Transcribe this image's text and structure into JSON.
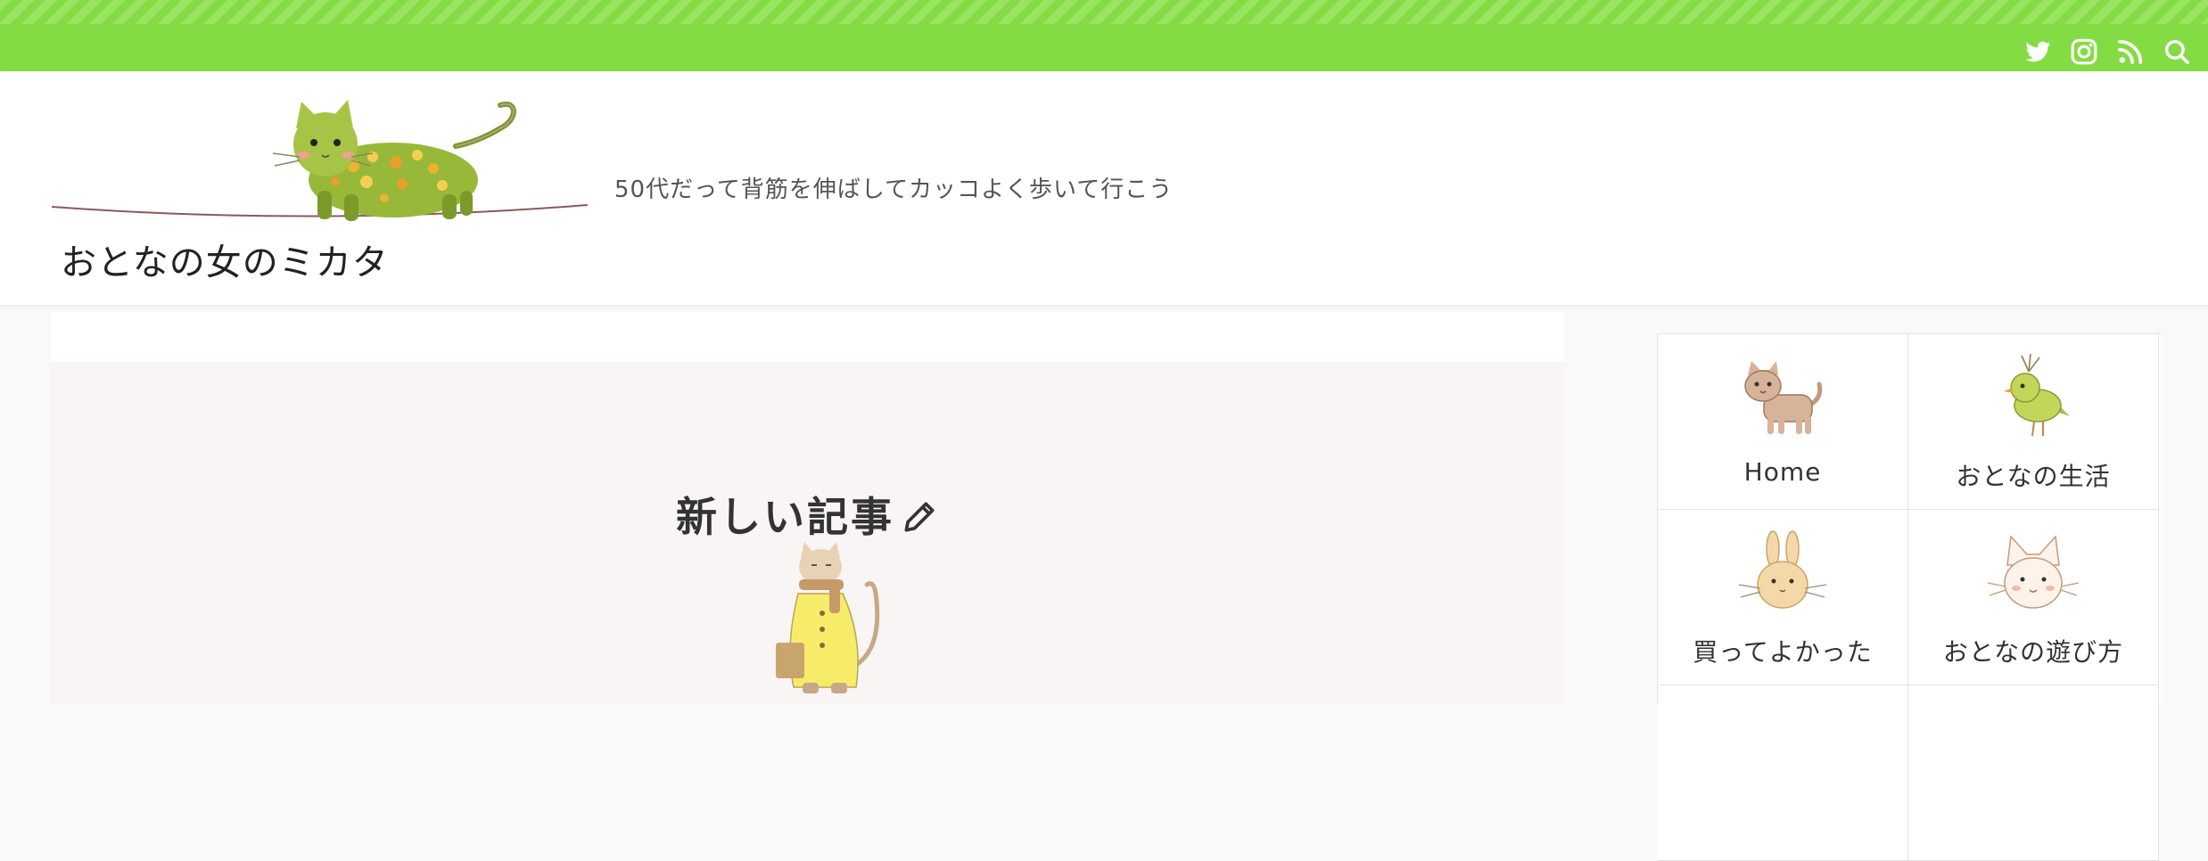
{
  "topbar": {
    "bg_color": "#84dc44",
    "icons": [
      "twitter-icon",
      "instagram-icon",
      "rss-icon",
      "search-icon"
    ]
  },
  "header": {
    "site_title": "おとなの女のミカタ",
    "tagline": "50代だって背筋を伸ばしてカッコよく歩いて行こう",
    "logo_image": "cat-on-tightrope-logo"
  },
  "main": {
    "section_heading": "新しい記事",
    "heading_icon": "pencil-icon",
    "heading_image": "cat-in-yellow-coat"
  },
  "sidebar": {
    "menu": [
      {
        "label": "Home",
        "icon": "brown-cat-icon"
      },
      {
        "label": "おとなの生活",
        "icon": "green-bird-icon"
      },
      {
        "label": "買ってよかった",
        "icon": "rabbit-icon"
      },
      {
        "label": "おとなの遊び方",
        "icon": "cat-face-icon"
      }
    ]
  }
}
